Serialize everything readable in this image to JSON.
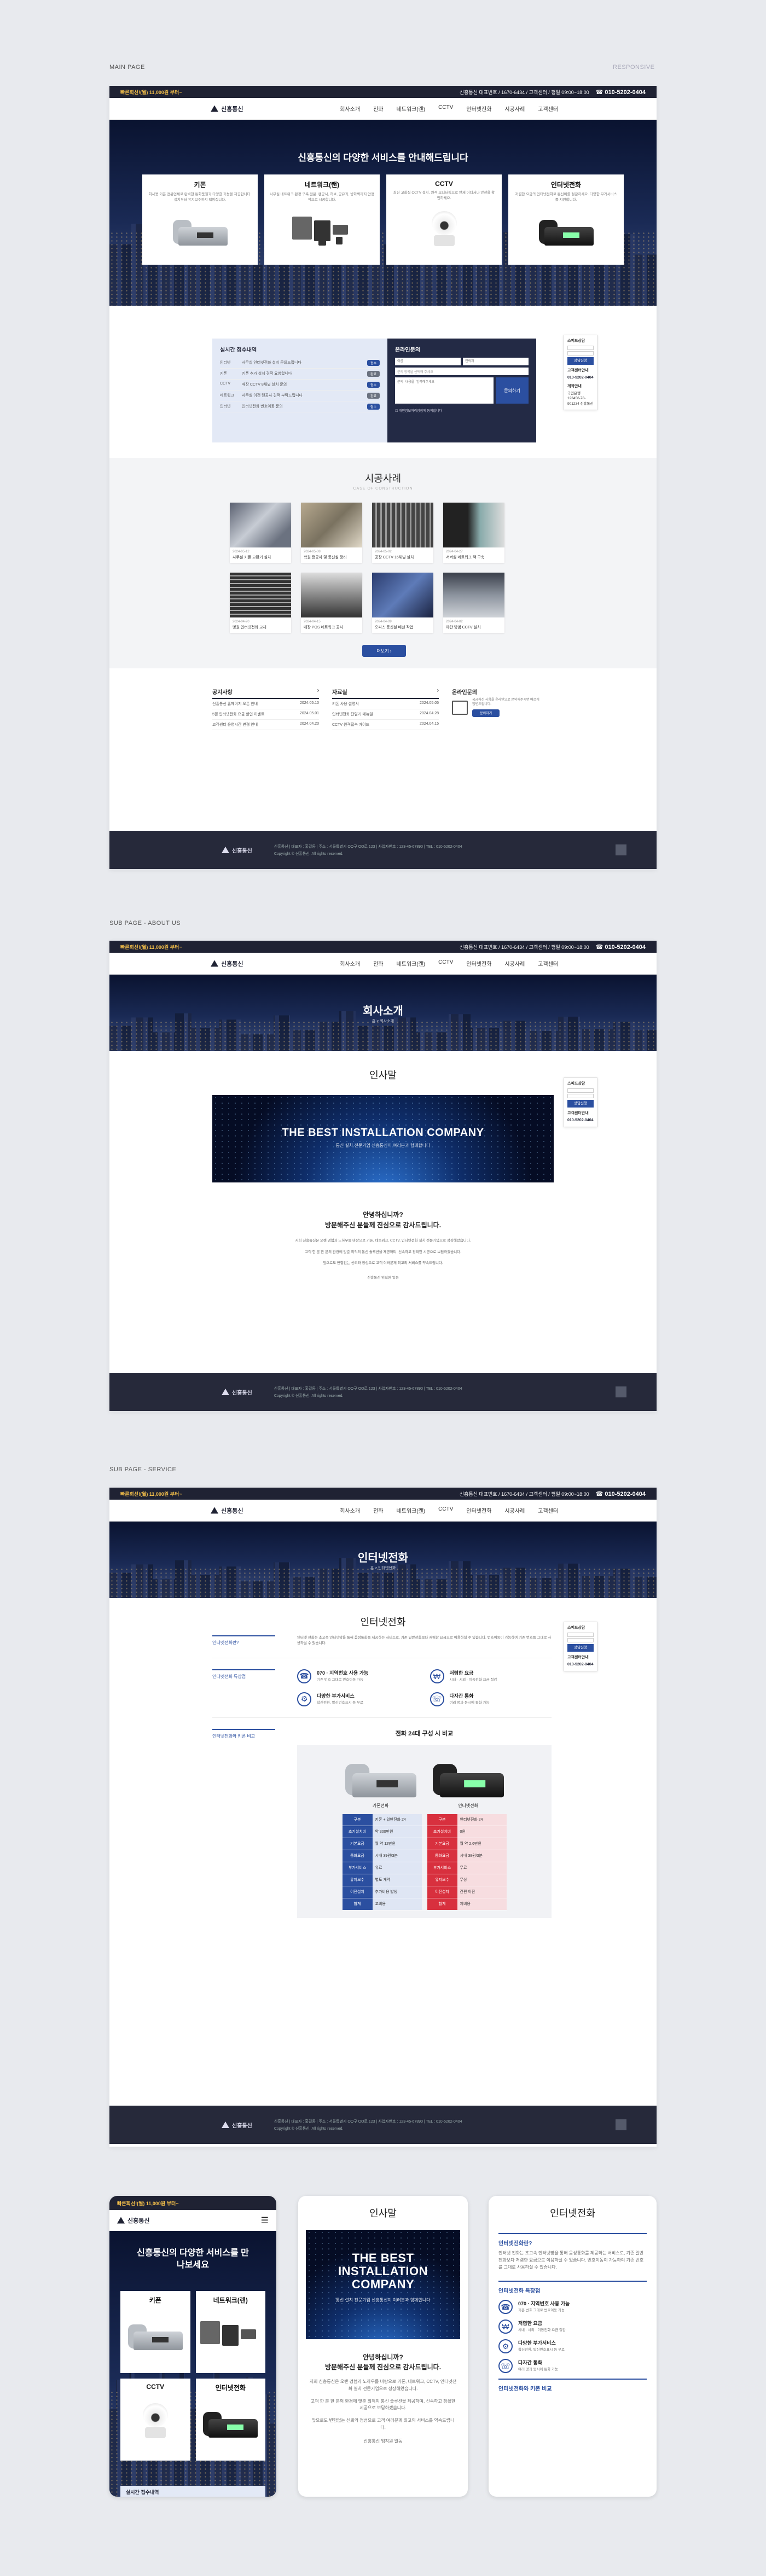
{
  "labels": {
    "main": "MAIN PAGE",
    "responsive": "RESPONSIVE",
    "about": "SUB PAGE - ABOUT US",
    "service": "SUB PAGE - SERVICE"
  },
  "topbar": {
    "promo": "빠른회선!(월) 11,000원 부터~",
    "info": "신흥통신 대표번호 / 1670-6434 / 고객센터 / 평일 09:00~18:00",
    "phone": "010-5202-0404"
  },
  "brand": {
    "name": "신흥통신"
  },
  "menu": [
    "회사소개",
    "전화",
    "네트워크(랜)",
    "CCTV",
    "인터넷전화",
    "시공사례",
    "고객센터"
  ],
  "hero": {
    "title": "신흥통신의 다양한 서비스를 안내해드립니다",
    "title_short": "신흥통신의 다양한 서비스를 만나보세요"
  },
  "services": [
    {
      "title": "키폰",
      "desc": "회사용 키폰 전문업체로 완벽한 통화품질과 다양한 기능을 제공합니다. 설치부터 유지보수까지 책임집니다."
    },
    {
      "title": "네트워크(랜)",
      "desc": "사무실 네트워크 환경 구축 전문. 랜공사, 허브, 공유기, 방화벽까지 안정적으로 시공합니다."
    },
    {
      "title": "CCTV",
      "desc": "최신 고화질 CCTV 설치, 원격 모니터링으로 언제 어디서나 안전을 확인하세요."
    },
    {
      "title": "인터넷전화",
      "desc": "저렴한 요금의 인터넷전화로 통신비를 절감하세요. 다양한 부가서비스를 지원합니다."
    }
  ],
  "consult": {
    "status_title": "실시간 접수내역",
    "rows": [
      {
        "cat": "인터넷",
        "text": "사무실 인터넷전화 설치 문의드립니다",
        "state": "접수"
      },
      {
        "cat": "키폰",
        "text": "키폰 추가 설치 견적 요청합니다",
        "state": "완료"
      },
      {
        "cat": "CCTV",
        "text": "매장 CCTV 8채널 설치 문의",
        "state": "접수"
      },
      {
        "cat": "네트워크",
        "text": "사무실 이전 랜공사 견적 부탁드립니다",
        "state": "완료"
      },
      {
        "cat": "인터넷",
        "text": "인터넷전화 번호이동 문의",
        "state": "접수"
      }
    ],
    "form_title": "온라인문의",
    "name_ph": "이름",
    "phone_ph": "연락처",
    "select_ph": "문의 항목을 선택해 주세요",
    "msg_ph": "문의 내용을 입력해주세요",
    "submit": "문의하기",
    "agree": "개인정보처리방침에 동의합니다"
  },
  "floating": {
    "title": "스피드상담",
    "name": "이름",
    "phone": "연락처",
    "btn": "상담신청",
    "cs_title": "고객센터안내",
    "cs_phone": "010-5202-0404",
    "bank_title": "계좌안내",
    "bank": "국민은행 123456-78-901234 신흥통신"
  },
  "cases": {
    "title": "시공사례",
    "sub": "CASE OF CONSTRUCTION",
    "more": "더보기",
    "items": [
      {
        "date": "2024-05-12",
        "title": "사무실 키폰 교환기 설치"
      },
      {
        "date": "2024-05-08",
        "title": "학원 랜공사 및 통신실 정리"
      },
      {
        "date": "2024-05-02",
        "title": "공장 CCTV 16채널 설치"
      },
      {
        "date": "2024-04-27",
        "title": "서버실 네트워크 랙 구축"
      },
      {
        "date": "2024-04-20",
        "title": "병원 인터넷전화 교체"
      },
      {
        "date": "2024-04-15",
        "title": "매장 POS 네트워크 공사"
      },
      {
        "date": "2024-04-09",
        "title": "오피스 통신실 배선 작업"
      },
      {
        "date": "2024-04-02",
        "title": "야간 방범 CCTV 설치"
      }
    ]
  },
  "board": {
    "notice_title": "공지사항",
    "data_title": "자료실",
    "online_title": "온라인문의",
    "notice": [
      {
        "t": "신흥통신 홈페이지 오픈 안내",
        "d": "2024.05.10"
      },
      {
        "t": "5월 인터넷전화 요금 할인 이벤트",
        "d": "2024.05.01"
      },
      {
        "t": "고객센터 운영시간 변경 안내",
        "d": "2024.04.20"
      }
    ],
    "data": [
      {
        "t": "키폰 사용 설명서",
        "d": "2024.05.05"
      },
      {
        "t": "인터넷전화 단말기 매뉴얼",
        "d": "2024.04.28"
      },
      {
        "t": "CCTV 원격접속 가이드",
        "d": "2024.04.15"
      }
    ],
    "online_desc": "궁금하신 사항을 온라인으로 문의해주시면 빠르게 답변드립니다.",
    "online_btn": "문의하기"
  },
  "footer": {
    "info": "신흥통신 | 대표자 : 홍길동 | 주소 : 서울특별시 OO구 OO로 123 | 사업자번호 : 123-45-67890 | TEL : 010-5202-0404",
    "copy": "Copyright © 신흥통신. All rights reserved."
  },
  "about": {
    "page_title": "회사소개",
    "breadcrumb": "홈 > 회사소개",
    "section": "인사말",
    "banner_title": "THE BEST INSTALLATION COMPANY",
    "banner_sub": "통신 설치 전문기업 신흥통신이 여러분과 함께합니다",
    "greeting1": "안녕하십니까?",
    "greeting2": "방문해주신 분들께 진심으로 감사드립니다.",
    "para1": "저희 신흥통신은 오랜 경험과 노하우를 바탕으로 키폰, 네트워크, CCTV, 인터넷전화 설치 전문기업으로 성장해왔습니다.",
    "para2": "고객 한 분 한 분의 환경에 맞춘 최적의 통신 솔루션을 제공하며, 신속하고 정확한 시공으로 보답하겠습니다.",
    "para3": "앞으로도 변함없는 신뢰와 정성으로 고객 여러분께 최고의 서비스를 약속드립니다.",
    "sign": "신흥통신 임직원 일동"
  },
  "service": {
    "page_title": "인터넷전화",
    "breadcrumb": "홈 > 인터넷전화",
    "section": "인터넷전화",
    "q_label": "인터넷전화란?",
    "q_text": "인터넷 전화는 초고속 인터넷망을 통해 음성통화를 제공하는 서비스로, 기존 일반전화보다 저렴한 요금으로 이용하실 수 있습니다. 번호이동이 가능하여 기존 번호를 그대로 사용하실 수 있습니다.",
    "feat_label": "인터넷전화 특장점",
    "features": [
      {
        "t": "070 · 지역번호 사용 가능",
        "d": "기존 번호 그대로 번호이동 가능"
      },
      {
        "t": "저렴한 요금",
        "d": "시내 · 시외 · 이동전화 요금 절감"
      },
      {
        "t": "다양한 부가서비스",
        "d": "착신전환, 발신번호표시 등 무료"
      },
      {
        "t": "다자간 통화",
        "d": "여러 명과 동시에 통화 가능"
      }
    ],
    "cmp_label": "인터넷전화와 키폰 비교",
    "cmp_title": "전화 24대 구성 시 비교",
    "phone_a": "키폰전화",
    "phone_b": "인터넷전화",
    "cmp_rows": [
      {
        "la": "구분",
        "va": "키폰 + 일반전화 24",
        "lb": "구분",
        "vb": "인터넷전화 24"
      },
      {
        "la": "초기설치비",
        "va": "약 300만원",
        "lb": "초기설치비",
        "vb": "0원"
      },
      {
        "la": "기본요금",
        "va": "월 약 12만원",
        "lb": "기본요금",
        "vb": "월 약 2.6만원"
      },
      {
        "la": "통화요금",
        "va": "시내 39원/3분",
        "lb": "통화요금",
        "vb": "시내 38원/3분"
      },
      {
        "la": "부가서비스",
        "va": "유료",
        "lb": "부가서비스",
        "vb": "무료"
      },
      {
        "la": "유지보수",
        "va": "별도 계약",
        "lb": "유지보수",
        "vb": "무상"
      },
      {
        "la": "이전설치",
        "va": "추가비용 발생",
        "lb": "이전설치",
        "vb": "간편 이전"
      },
      {
        "la": "합계",
        "va": "고비용",
        "lb": "합계",
        "vb": "저비용"
      }
    ]
  },
  "colors": {
    "navy": "#1f2233",
    "accent": "#2b4fa0",
    "promo": "#f5c04a",
    "red": "#d8303e"
  }
}
